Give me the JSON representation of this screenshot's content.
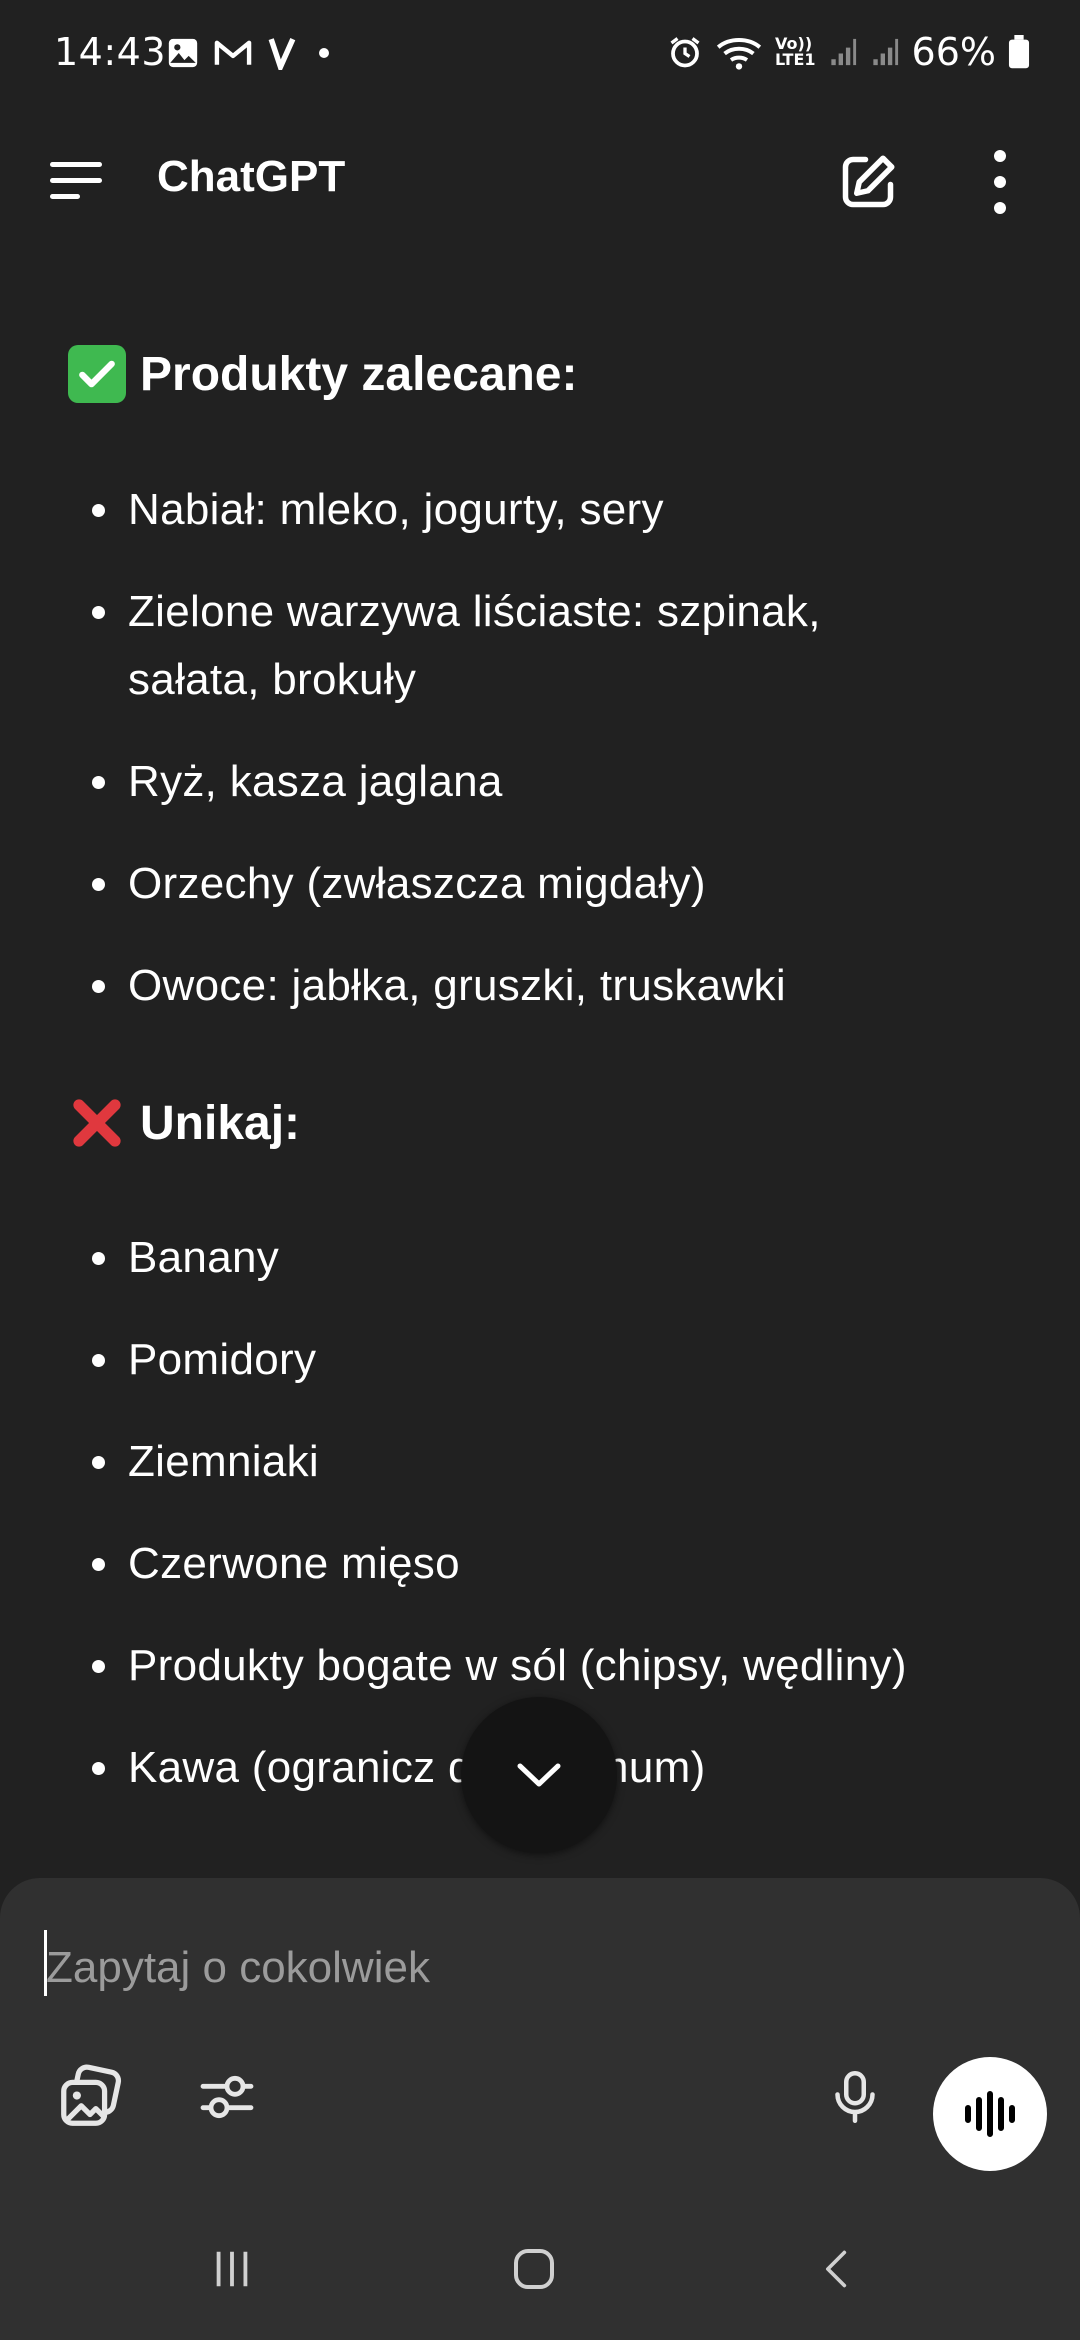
{
  "status_bar": {
    "time": "14:43",
    "battery_percent": "66%",
    "network_label": "LTE1"
  },
  "app_bar": {
    "title": "ChatGPT"
  },
  "message": {
    "sections": [
      {
        "icon": "check-mark-emoji",
        "title": "Produkty zalecane:",
        "items": [
          "Nabiał: mleko, jogurty, sery",
          "Zielone warzywa liściaste: szpinak, sałata, brokuły",
          "Ryż, kasza jaglana",
          "Orzechy (zwłaszcza migdały)",
          "Owoce: jabłka, gruszki, truskawki"
        ]
      },
      {
        "icon": "cross-mark-emoji",
        "title": "Unikaj:",
        "items": [
          "Banany",
          "Pomidory",
          "Ziemniaki",
          "Czerwone mięso",
          "Produkty bogate w sól (chipsy, wędliny)",
          "Kawa (ogranicz do minimum)"
        ]
      }
    ]
  },
  "composer": {
    "placeholder": "Zapytaj o cokolwiek"
  },
  "colors": {
    "background": "#212121",
    "composer": "#303030",
    "check_green": "#3fb950",
    "cross_red": "#e0383e"
  }
}
